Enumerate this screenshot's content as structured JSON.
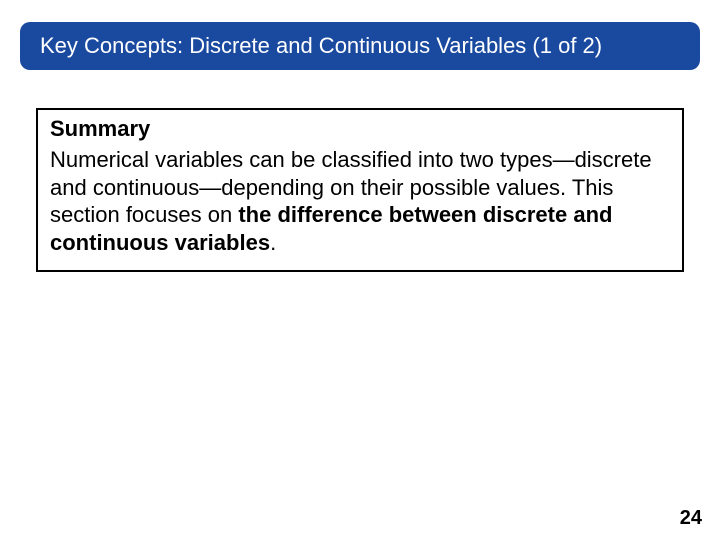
{
  "title": "Key Concepts: Discrete and Continuous Variables (1 of 2)",
  "summary": {
    "heading": "Summary",
    "body_plain": "Numerical variables can be classified into two types—discrete and continuous—depending on their possible values. This section focuses on ",
    "body_bold": "the difference between discrete and continuous variables",
    "body_tail": "."
  },
  "page_number": "24"
}
